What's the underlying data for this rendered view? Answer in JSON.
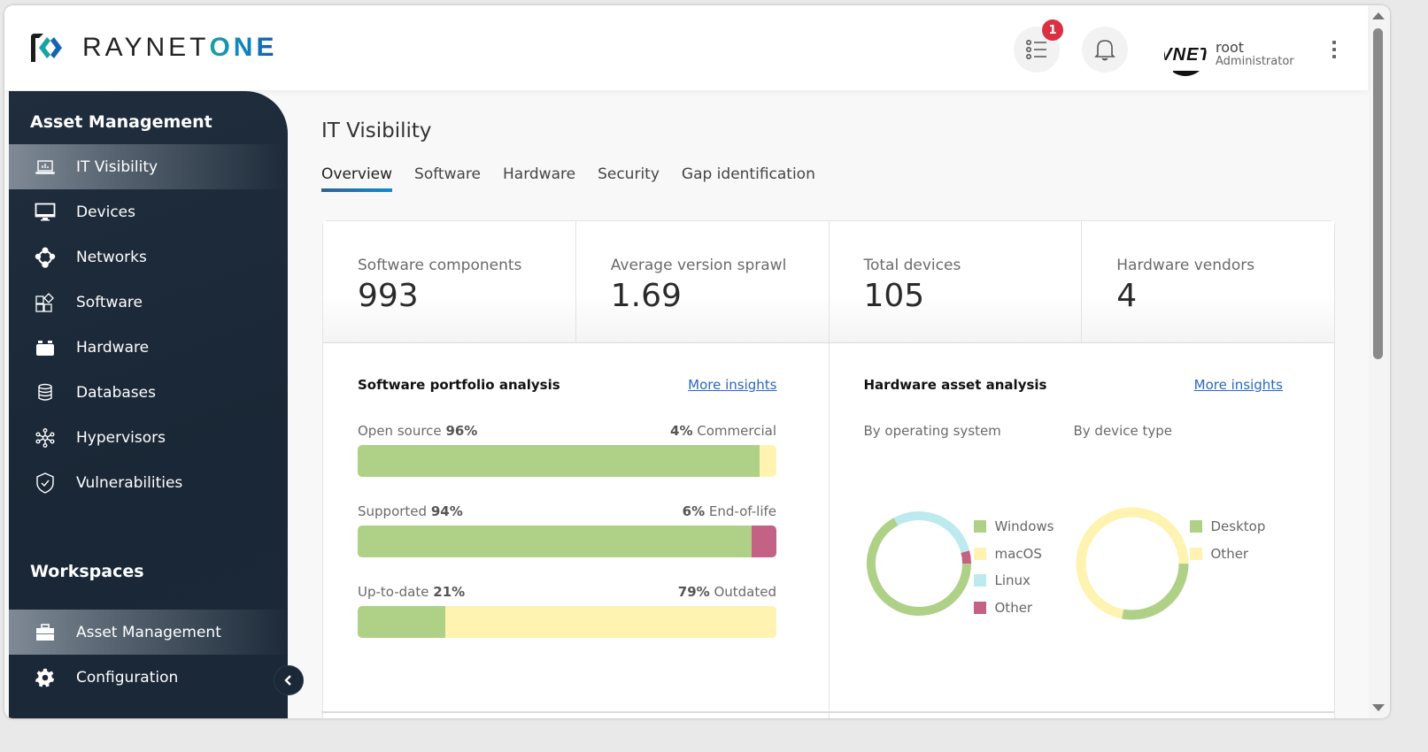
{
  "app": {
    "brand_prefix": "RAYNET",
    "brand_suffix": "ONE"
  },
  "header": {
    "task_badge_count": "1",
    "user": {
      "avatar_text": "VNET",
      "name": "root",
      "role": "Administrator"
    },
    "icons": {
      "tasks": "task-list-icon",
      "notifications": "bell-icon",
      "more": "more-vert-icon"
    }
  },
  "sidebar": {
    "section_title": "Asset Management",
    "items": [
      {
        "label": "IT Visibility",
        "icon": "laptop-chart-icon",
        "active": true
      },
      {
        "label": "Devices",
        "icon": "monitor-icon",
        "active": false
      },
      {
        "label": "Networks",
        "icon": "network-icon",
        "active": false
      },
      {
        "label": "Software",
        "icon": "software-blocks-icon",
        "active": false
      },
      {
        "label": "Hardware",
        "icon": "hardware-icon",
        "active": false
      },
      {
        "label": "Databases",
        "icon": "database-icon",
        "active": false
      },
      {
        "label": "Hypervisors",
        "icon": "hypervisor-icon",
        "active": false
      },
      {
        "label": "Vulnerabilities",
        "icon": "shield-check-icon",
        "active": false
      }
    ],
    "workspaces_title": "Workspaces",
    "workspaces": [
      {
        "label": "Asset Management",
        "icon": "toolbox-icon",
        "active": true
      },
      {
        "label": "Configuration",
        "icon": "gear-icon",
        "active": false
      }
    ],
    "collapse_icon": "chevron-left-icon"
  },
  "main": {
    "title": "IT Visibility",
    "tabs": [
      {
        "label": "Overview",
        "active": true
      },
      {
        "label": "Software",
        "active": false
      },
      {
        "label": "Hardware",
        "active": false
      },
      {
        "label": "Security",
        "active": false
      },
      {
        "label": "Gap identification",
        "active": false
      }
    ],
    "kpis": [
      {
        "label": "Software components",
        "value": "993"
      },
      {
        "label": "Average version sprawl",
        "value": "1.69"
      },
      {
        "label": "Total devices",
        "value": "105"
      },
      {
        "label": "Hardware vendors",
        "value": "4"
      }
    ],
    "software_panel": {
      "title": "Software portfolio analysis",
      "link": "More insights",
      "bars": [
        {
          "left_label": "Open source",
          "left_pct": "96%",
          "right_pct": "4%",
          "right_label": "Commercial",
          "left_value": 96,
          "right_value": 4,
          "left_color": "#aed187",
          "right_color": "#fef3b0"
        },
        {
          "left_label": "Supported",
          "left_pct": "94%",
          "right_pct": "6%",
          "right_label": "End-of-life",
          "left_value": 94,
          "right_value": 6,
          "left_color": "#aed187",
          "right_color": "#c46285"
        },
        {
          "left_label": "Up-to-date",
          "left_pct": "21%",
          "right_pct": "79%",
          "right_label": "Outdated",
          "left_value": 21,
          "right_value": 79,
          "left_color": "#aed187",
          "right_color": "#fef3b0"
        }
      ]
    },
    "hardware_panel": {
      "title": "Hardware asset analysis",
      "link": "More insights",
      "os_label": "By operating system",
      "device_label": "By device type"
    }
  },
  "chart_data": [
    {
      "type": "pie",
      "title": "By operating system",
      "donut": true,
      "legend": "right",
      "categories": [
        "Windows",
        "macOS",
        "Linux",
        "Other"
      ],
      "values": [
        67,
        0,
        29,
        4
      ],
      "colors": [
        "#aed187",
        "#fef3b0",
        "#bdeaee",
        "#c46285"
      ]
    },
    {
      "type": "pie",
      "title": "By device type",
      "donut": true,
      "legend": "right",
      "categories": [
        "Desktop",
        "Other"
      ],
      "values": [
        28,
        72
      ],
      "colors": [
        "#aed187",
        "#fef3b0"
      ]
    }
  ]
}
